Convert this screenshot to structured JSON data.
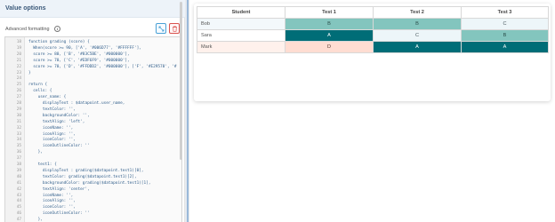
{
  "panel": {
    "title": "Value options",
    "advanced_label": "Advanced formatting",
    "info_icon": "info-icon",
    "expand_icon": "expand-icon",
    "delete_icon": "trash-icon",
    "accent_color": "#4aa1d6",
    "danger_color": "#d9534f"
  },
  "code": {
    "lines": [
      {
        "n": "18",
        "t": "function grading (score) {"
      },
      {
        "n": "19",
        "t": "  When(score >= 90, ['A', '#006D77', '#FFFFFF'],"
      },
      {
        "n": "20",
        "t": "  score >= 80, ['B', '#83C5BE', '#000000'],"
      },
      {
        "n": "21",
        "t": "  score >= 70, ['C', '#EDF6F9', '#000000'],"
      },
      {
        "n": "22",
        "t": "  score >= 70, ['D', '#FFDDD2', '#000000'], ['F', '#E29578', '#"
      },
      {
        "n": "23",
        "t": "}"
      },
      {
        "n": "24",
        "t": ""
      },
      {
        "n": "25",
        "t": "return {"
      },
      {
        "n": "26",
        "t": "  cells: {"
      },
      {
        "n": "27",
        "t": "    user_name: {"
      },
      {
        "n": "28",
        "t": "      displayText : $datapoint.user_name,"
      },
      {
        "n": "29",
        "t": "      textColor: '',"
      },
      {
        "n": "30",
        "t": "      backgroundColor: '',"
      },
      {
        "n": "31",
        "t": "      textAlign: 'left',"
      },
      {
        "n": "32",
        "t": "      iconName: '',"
      },
      {
        "n": "33",
        "t": "      iconAlign: '',"
      },
      {
        "n": "34",
        "t": "      iconColor: '',"
      },
      {
        "n": "35",
        "t": "      iconOutlineColor: ''"
      },
      {
        "n": "36",
        "t": "    },"
      },
      {
        "n": "37",
        "t": ""
      },
      {
        "n": "38",
        "t": "    test1: {"
      },
      {
        "n": "39",
        "t": "      displayText : grading($datapoint.test1)[0],"
      },
      {
        "n": "40",
        "t": "      textColor: grading($datapoint.test1)[2],"
      },
      {
        "n": "41",
        "t": "      backgroundColor: grading($datapoint.test1)[1],"
      },
      {
        "n": "42",
        "t": "      textAlign: 'center',"
      },
      {
        "n": "43",
        "t": "      iconName: '',"
      },
      {
        "n": "44",
        "t": "      iconAlign: '',"
      },
      {
        "n": "45",
        "t": "      iconColor: '',"
      },
      {
        "n": "46",
        "t": "      iconOutlineColor: ''"
      },
      {
        "n": "47",
        "t": "    },"
      }
    ]
  },
  "table": {
    "headers": [
      "Student",
      "Test 1",
      "Test 2",
      "Test 3"
    ],
    "rows": [
      {
        "name": "Bob",
        "cells": [
          {
            "grade": "B",
            "bg": "#83C5BE",
            "color": "#2b4f4b"
          },
          {
            "grade": "B",
            "bg": "#83C5BE",
            "color": "#2b4f4b"
          },
          {
            "grade": "C",
            "bg": "#EDF6F9",
            "color": "#4a5a60"
          }
        ]
      },
      {
        "name": "Sara",
        "cells": [
          {
            "grade": "A",
            "bg": "#006D77",
            "color": "#FFFFFF"
          },
          {
            "grade": "C",
            "bg": "#EDF6F9",
            "color": "#4a5a60"
          },
          {
            "grade": "B",
            "bg": "#83C5BE",
            "color": "#2b4f4b"
          }
        ]
      },
      {
        "name": "Mark",
        "cells": [
          {
            "grade": "D",
            "bg": "#FFDDD2",
            "color": "#5a3a30"
          },
          {
            "grade": "A",
            "bg": "#006D77",
            "color": "#FFFFFF"
          },
          {
            "grade": "A",
            "bg": "#006D77",
            "color": "#FFFFFF"
          }
        ]
      }
    ],
    "name_row_bg": [
      "#f3f8fb",
      "#ffffff",
      "#fff1ec"
    ]
  }
}
